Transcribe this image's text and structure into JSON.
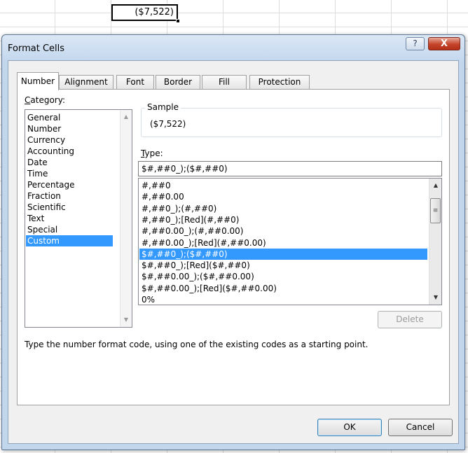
{
  "sheet": {
    "active_cell_value": "($7,522)"
  },
  "dialog": {
    "title": "Format Cells",
    "help_label": "?",
    "close_label": "X",
    "tabs": [
      {
        "label": "Number",
        "active": true
      },
      {
        "label": "Alignment"
      },
      {
        "label": "Font"
      },
      {
        "label": "Border"
      },
      {
        "label": "Fill"
      },
      {
        "label": "Protection"
      }
    ],
    "category_label": "Category:",
    "categories": [
      "General",
      "Number",
      "Currency",
      "Accounting",
      "Date",
      "Time",
      "Percentage",
      "Fraction",
      "Scientific",
      "Text",
      "Special",
      "Custom"
    ],
    "selected_category": "Custom",
    "sample_label": "Sample",
    "sample_value": "($7,522)",
    "type_label": "Type:",
    "type_value": "$#,##0_);($#,##0)",
    "formats": [
      "#,##0",
      "#,##0.00",
      "#,##0_);(#,##0)",
      "#,##0_);[Red](#,##0)",
      "#,##0.00_);(#,##0.00)",
      "#,##0.00_);[Red](#,##0.00)",
      "$#,##0_);($#,##0)",
      "$#,##0_);[Red]($#,##0)",
      "$#,##0.00_);($#,##0.00)",
      "$#,##0.00_);[Red]($#,##0.00)",
      "0%"
    ],
    "selected_format": "$#,##0_);($#,##0)",
    "delete_label": "Delete",
    "hint": "Type the number format code, using one of the existing codes as a starting point.",
    "ok_label": "OK",
    "cancel_label": "Cancel"
  },
  "colors": {
    "selection": "#3399ff",
    "title_bar": "#c4d8ee",
    "close_button": "#c6432b"
  }
}
